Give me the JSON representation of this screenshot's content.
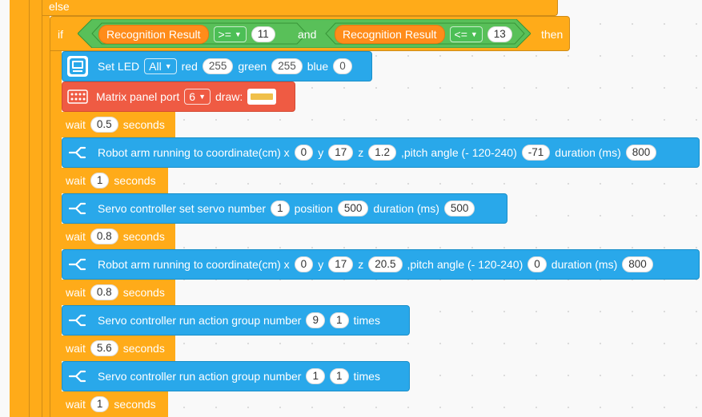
{
  "else_label": "else",
  "if_block": {
    "if_label": "if",
    "and_label": "and",
    "then_label": "then",
    "left": {
      "reporter": "Recognition Result",
      "operator": ">=",
      "value": "11"
    },
    "right": {
      "reporter": "Recognition Result",
      "operator": "<=",
      "value": "13"
    }
  },
  "blocks": {
    "led": {
      "prefix": "Set LED",
      "target": "All",
      "red_label": "red",
      "red": "255",
      "green_label": "green",
      "green": "255",
      "blue_label": "blue",
      "blue": "0"
    },
    "matrix": {
      "prefix": "Matrix panel port",
      "port": "6",
      "draw_label": "draw:"
    },
    "wait1": {
      "label": "wait",
      "value": "0.5",
      "unit": "seconds"
    },
    "arm1": {
      "prefix": "Robot arm running to coordinate(cm) x",
      "x": "0",
      "y_label": "y",
      "y": "17",
      "z_label": "z",
      "z": "1.2",
      "pitch_label": ",pitch angle (- 120-240)",
      "pitch": "-71",
      "dur_label": "duration (ms)",
      "dur": "800"
    },
    "wait2": {
      "label": "wait",
      "value": "1",
      "unit": "seconds"
    },
    "servo": {
      "prefix": "Servo controller set servo number",
      "num": "1",
      "pos_label": "position",
      "pos": "500",
      "dur_label": "duration (ms)",
      "dur": "500"
    },
    "wait3": {
      "label": "wait",
      "value": "0.8",
      "unit": "seconds"
    },
    "arm2": {
      "prefix": "Robot arm running to coordinate(cm) x",
      "x": "0",
      "y_label": "y",
      "y": "17",
      "z_label": "z",
      "z": "20.5",
      "pitch_label": ",pitch angle (- 120-240)",
      "pitch": "0",
      "dur_label": "duration (ms)",
      "dur": "800"
    },
    "wait4": {
      "label": "wait",
      "value": "0.8",
      "unit": "seconds"
    },
    "group1": {
      "prefix": "Servo controller run action group number",
      "num": "9",
      "times_value": "1",
      "times_label": "times"
    },
    "wait5": {
      "label": "wait",
      "value": "5.6",
      "unit": "seconds"
    },
    "group2": {
      "prefix": "Servo controller run action group number",
      "num": "1",
      "times_value": "1",
      "times_label": "times"
    },
    "wait6": {
      "label": "wait",
      "value": "1",
      "unit": "seconds"
    }
  },
  "colors": {
    "control": "#ffab19",
    "operator": "#59c059",
    "reporter": "#ff8c1a",
    "action": "#29a8ea",
    "matrix": "#ef5b43"
  },
  "icons": {
    "led": "led-panel-icon",
    "matrix": "matrix-panel-icon",
    "arm": "robot-arm-icon",
    "dropdown": "caret-down-icon"
  }
}
